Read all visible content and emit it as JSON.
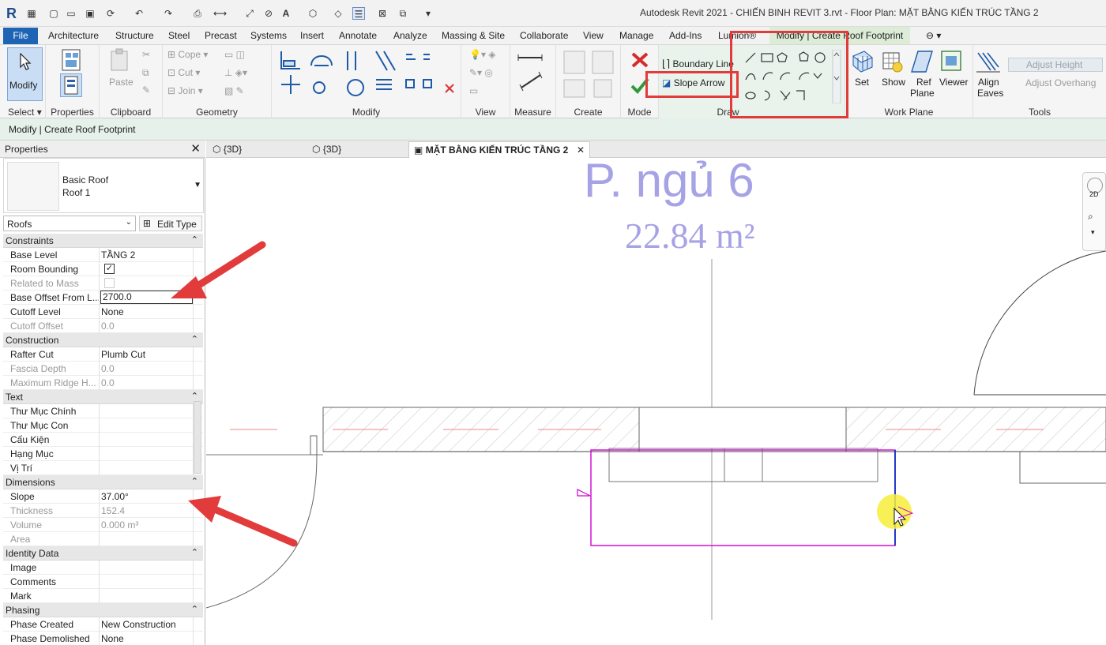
{
  "app": {
    "title": "Autodesk Revit 2021 - CHIẾN BINH REVIT 3.rvt - Floor Plan: MẶT BẰNG KIẾN TRÚC TẦNG 2",
    "logo": "R"
  },
  "tabs": {
    "file": "File",
    "items": [
      "Architecture",
      "Structure",
      "Steel",
      "Precast",
      "Systems",
      "Insert",
      "Annotate",
      "Analyze",
      "Massing & Site",
      "Collaborate",
      "View",
      "Manage",
      "Add-Ins",
      "Lumion®"
    ],
    "active": "Modify | Create Roof Footprint"
  },
  "ribbon": {
    "select": {
      "modify": "Modify",
      "panel": "Select"
    },
    "properties": {
      "panel": "Properties"
    },
    "clipboard": {
      "paste": "Paste",
      "panel": "Clipboard"
    },
    "geometry": {
      "cope": "Cope",
      "cut": "Cut",
      "join": "Join",
      "panel": "Geometry"
    },
    "modify": {
      "panel": "Modify"
    },
    "view": {
      "panel": "View"
    },
    "measure": {
      "panel": "Measure"
    },
    "create": {
      "panel": "Create"
    },
    "mode": {
      "panel": "Mode"
    },
    "draw": {
      "boundary_line": "Boundary Line",
      "slope_arrow": "Slope Arrow",
      "panel": "Draw"
    },
    "workplane": {
      "set": "Set",
      "show": "Show",
      "ref": "Ref",
      "plane": "Plane",
      "viewer": "Viewer",
      "panel": "Work Plane"
    },
    "tools": {
      "align": "Align",
      "eaves": "Eaves",
      "adjust_height": "Adjust  Height",
      "adjust_overhang": "Adjust  Overhang",
      "panel": "Tools"
    }
  },
  "context_bar": "Modify | Create Roof Footprint",
  "properties": {
    "title": "Properties",
    "type_family": "Basic Roof",
    "type_name": "Roof 1",
    "filter": "Roofs",
    "edit_type": "Edit Type",
    "groups": [
      {
        "name": "Constraints",
        "rows": [
          {
            "k": "Base Level",
            "v": "TẦNG 2",
            "g": false
          },
          {
            "k": "Room Bounding",
            "v": "",
            "check": true,
            "g": false
          },
          {
            "k": "Related to Mass",
            "v": "",
            "check_dim": true,
            "g": true
          },
          {
            "k": "Base Offset From L...",
            "v": "2700.0",
            "edit": true,
            "g": false
          },
          {
            "k": "Cutoff Level",
            "v": "None",
            "g": false
          },
          {
            "k": "Cutoff Offset",
            "v": "0.0",
            "g": true
          }
        ]
      },
      {
        "name": "Construction",
        "rows": [
          {
            "k": "Rafter Cut",
            "v": "Plumb Cut",
            "g": false
          },
          {
            "k": "Fascia Depth",
            "v": "0.0",
            "g": true
          },
          {
            "k": "Maximum Ridge H...",
            "v": "0.0",
            "g": true
          }
        ]
      },
      {
        "name": "Text",
        "rows": [
          {
            "k": "Thư Mục Chính",
            "v": "",
            "g": false
          },
          {
            "k": "Thư Mục Con",
            "v": "",
            "g": false
          },
          {
            "k": "Cấu Kiện",
            "v": "",
            "g": false
          },
          {
            "k": "Hạng Mục",
            "v": "",
            "g": false
          },
          {
            "k": "Vị Trí",
            "v": "",
            "g": false
          }
        ]
      },
      {
        "name": "Dimensions",
        "rows": [
          {
            "k": "Slope",
            "v": "37.00°",
            "g": false
          },
          {
            "k": "Thickness",
            "v": "152.4",
            "g": true
          },
          {
            "k": "Volume",
            "v": "0.000 m³",
            "g": true
          },
          {
            "k": "Area",
            "v": "",
            "g": true
          }
        ]
      },
      {
        "name": "Identity Data",
        "rows": [
          {
            "k": "Image",
            "v": "",
            "g": false
          },
          {
            "k": "Comments",
            "v": "",
            "g": false
          },
          {
            "k": "Mark",
            "v": "",
            "g": false
          }
        ]
      },
      {
        "name": "Phasing",
        "rows": [
          {
            "k": "Phase Created",
            "v": "New Construction",
            "g": false
          },
          {
            "k": "Phase Demolished",
            "v": "None",
            "g": false
          }
        ]
      }
    ]
  },
  "view_tabs": [
    {
      "label": "{3D}",
      "active": false
    },
    {
      "label": "{3D}",
      "active": false
    },
    {
      "label": "MẶT BẰNG KIẾN TRÚC TẦNG 2",
      "active": true
    }
  ],
  "canvas": {
    "room_name": "P. ngủ 6",
    "room_area": "22.84 m²",
    "nav_2d": "2D"
  },
  "colors": {
    "accent_blue": "#1e64b4",
    "contextual_green": "#dcecd6",
    "highlight_red": "#e23b3b",
    "sketch_magenta": "#d100d1",
    "room_tag": "#a6a2e6"
  }
}
